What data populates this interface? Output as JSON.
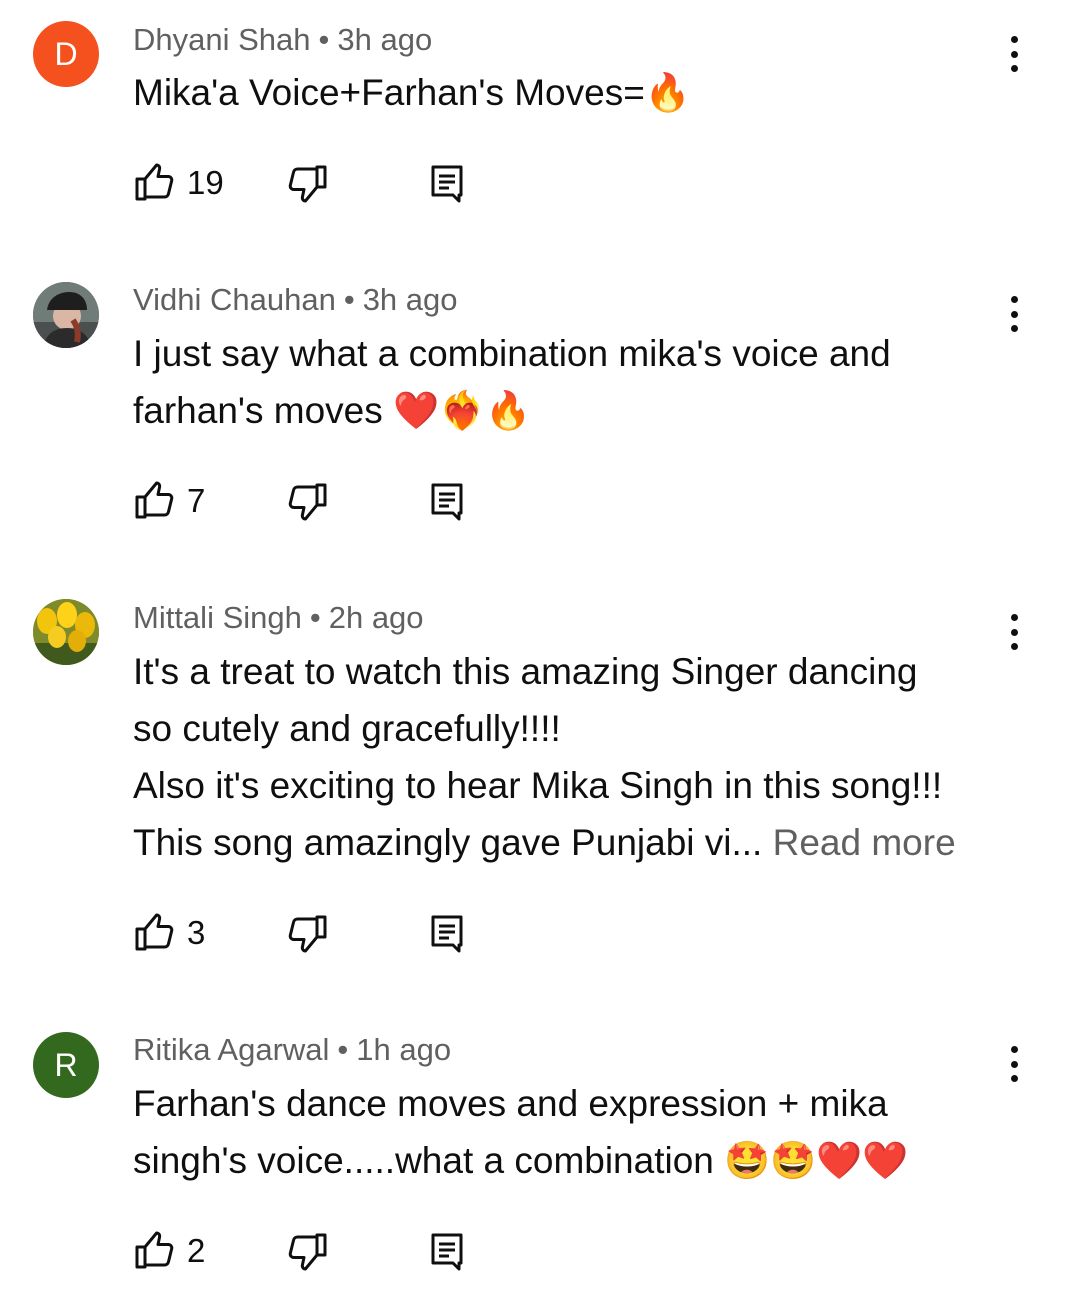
{
  "comments": [
    {
      "author": "Dhyani Shah",
      "time": "3h ago",
      "avatar": {
        "type": "letter",
        "letter": "D",
        "color": "#f4511e"
      },
      "text": "Mika'a Voice+Farhan's Moves=🔥",
      "likes": "19"
    },
    {
      "author": "Vidhi Chauhan",
      "time": "3h ago",
      "avatar": {
        "type": "photo",
        "icon": "person-in-cap-photo"
      },
      "text": "I just say what a combination mika's voice and\nfarhan's moves ❤️❤️‍🔥🔥",
      "likes": "7"
    },
    {
      "author": "Mittali Singh",
      "time": "2h ago",
      "avatar": {
        "type": "photo",
        "icon": "yellow-tulips-photo"
      },
      "text": "It's a treat to watch this amazing Singer dancing\nso cutely and gracefully!!!!\nAlso it's exciting to hear Mika Singh in this song!!!\nThis song amazingly gave Punjabi vi... ",
      "read_more": "Read more",
      "likes": "3"
    },
    {
      "author": "Ritika Agarwal",
      "time": "1h ago",
      "avatar": {
        "type": "letter",
        "letter": "R",
        "color": "#33691e"
      },
      "text": "Farhan's dance moves and expression + mika\nsingh's voice.....what a combination 🤩🤩❤️❤️",
      "likes": "2"
    }
  ],
  "separator": "•",
  "icons": {
    "like": "thumbs-up-icon",
    "dislike": "thumbs-down-icon",
    "reply": "reply-icon",
    "menu": "more-vertical-icon"
  }
}
